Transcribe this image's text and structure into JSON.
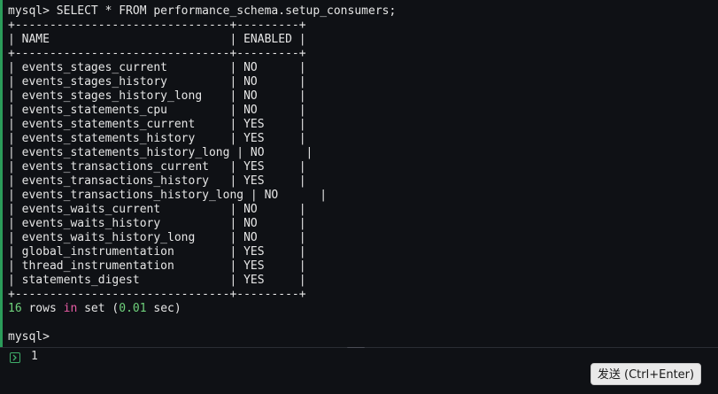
{
  "terminal": {
    "command_line": "mysql> SELECT * FROM performance_schema.setup_consumers;",
    "table": {
      "border": "+-------------------------------+---------+",
      "header_row": "| NAME                          | ENABLED |",
      "rows": [
        "| events_stages_current         | NO      |",
        "| events_stages_history         | NO      |",
        "| events_stages_history_long    | NO      |",
        "| events_statements_cpu         | NO      |",
        "| events_statements_current     | YES     |",
        "| events_statements_history     | YES     |",
        "| events_statements_history_long | NO      |",
        "| events_transactions_current   | YES     |",
        "| events_transactions_history   | YES     |",
        "| events_transactions_history_long | NO      |",
        "| events_waits_current          | NO      |",
        "| events_waits_history          | NO      |",
        "| events_waits_history_long     | NO      |",
        "| global_instrumentation        | YES     |",
        "| thread_instrumentation        | YES     |",
        "| statements_digest             | YES     |"
      ]
    },
    "result": {
      "count": "16",
      "text1": " rows ",
      "kw_in": "in",
      "text2": " set (",
      "time": "0.01",
      "text3": " sec)"
    },
    "prompt": "mysql>"
  },
  "input": {
    "line_number": "1"
  },
  "send_button": {
    "label": "发送 (Ctrl+Enter)"
  }
}
